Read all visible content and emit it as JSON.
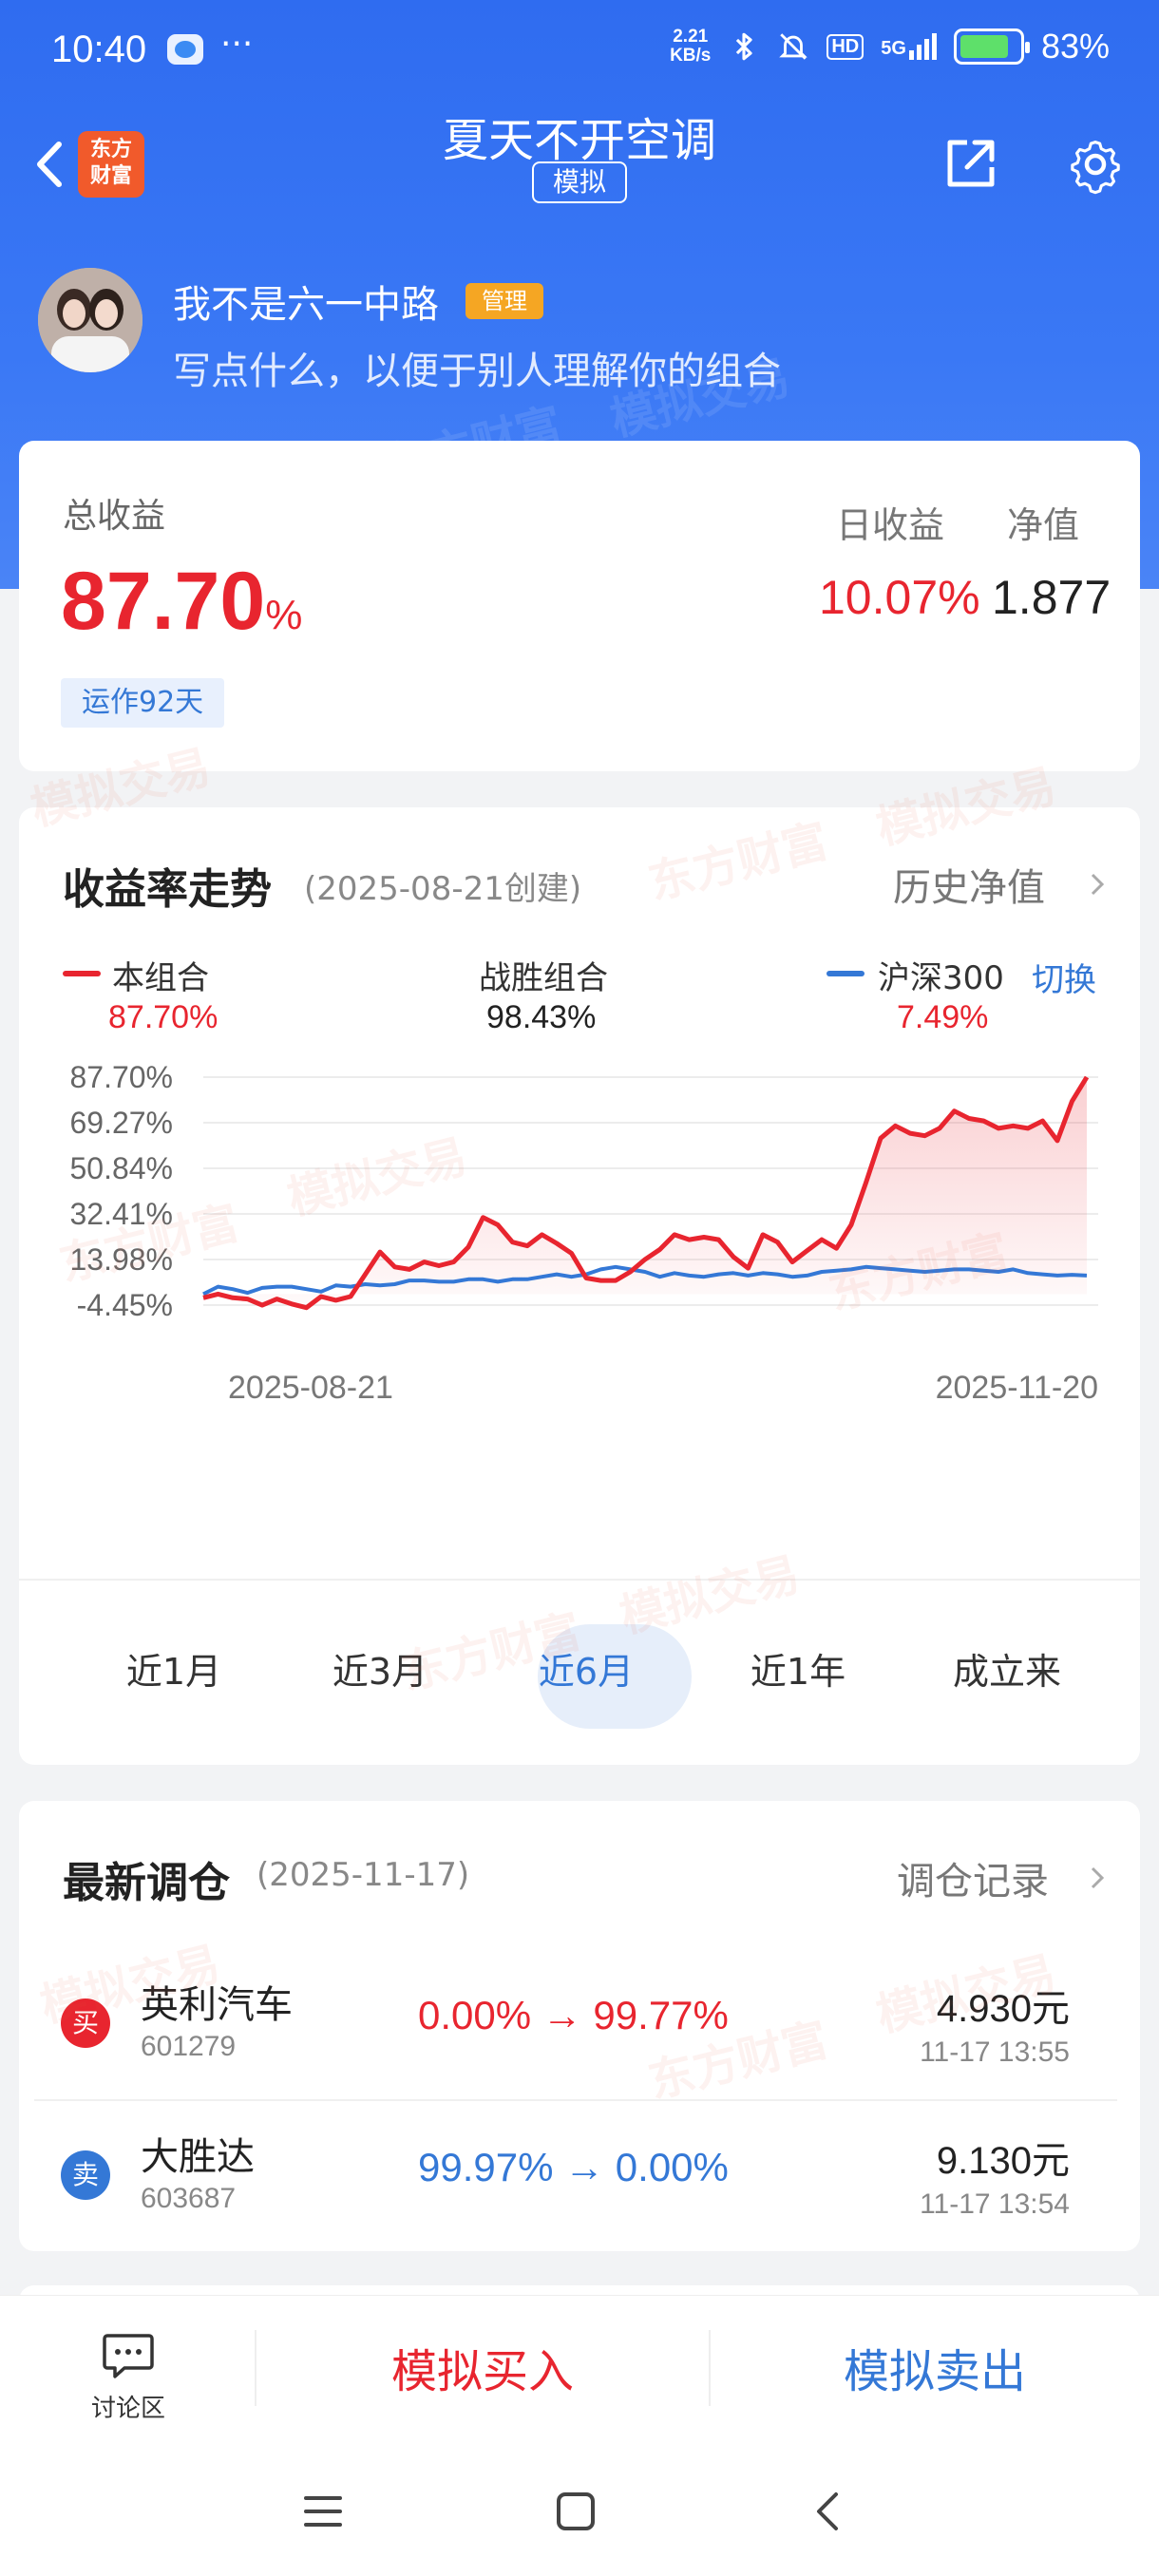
{
  "status_bar": {
    "time": "10:40",
    "more": "···",
    "net_speed_value": "2.21",
    "net_speed_unit": "KB/s",
    "signal": "5G",
    "hd": "HD",
    "battery": "83%"
  },
  "header": {
    "brand": [
      "东方",
      "财富"
    ],
    "title": "夏天不开空调",
    "mode_tag": "模拟"
  },
  "user": {
    "name": "我不是六一中路",
    "role_tag": "管理",
    "description": "写点什么，以便于别人理解你的组合"
  },
  "summary": {
    "total_label": "总收益",
    "total_value": "87.70",
    "total_unit": "%",
    "running_tag": "运作92天",
    "day_label": "日收益",
    "day_value": "10.07%",
    "nav_label": "净值",
    "nav_value": "1.877"
  },
  "chart_section": {
    "title": "收益率走势",
    "created": "(2025-08-21创建)",
    "history_link": "历史净值",
    "legend": [
      {
        "label": "本组合",
        "value": "87.70%",
        "color": "#e8252f"
      },
      {
        "label": "战胜组合",
        "value": "98.43%"
      },
      {
        "label": "沪深300",
        "value": "7.49%",
        "color": "#3478d6"
      }
    ],
    "switch_label": "切换",
    "tabs": [
      "近1月",
      "近3月",
      "近6月",
      "近1年",
      "成立来"
    ],
    "active_tab": "近6月"
  },
  "chart_data": {
    "type": "line",
    "yticks": [
      "87.70%",
      "69.27%",
      "50.84%",
      "32.41%",
      "13.98%",
      "-4.45%"
    ],
    "ylim": [
      -4.45,
      87.7
    ],
    "xticks": [
      "2025-08-21",
      "2025-11-20"
    ],
    "series": [
      {
        "name": "本组合",
        "color": "#e8252f",
        "values": [
          -1.5,
          0,
          -1.5,
          -2,
          -4.5,
          -2,
          -4,
          -5.5,
          -1,
          -2.5,
          -1,
          8,
          17,
          11,
          10,
          13,
          11.5,
          13,
          19,
          31,
          28,
          21,
          19.5,
          24,
          20.5,
          16.5,
          6.5,
          5.5,
          5.5,
          9,
          14,
          18,
          24,
          22,
          23,
          22,
          15,
          10.5,
          24,
          21,
          13,
          17.5,
          22,
          18.5,
          28,
          45,
          63,
          68,
          65,
          64,
          67,
          74,
          71,
          70,
          67,
          68,
          67,
          70,
          62,
          78,
          87.7
        ]
      },
      {
        "name": "沪深300",
        "color": "#3478d6",
        "values": [
          0,
          3,
          2,
          0.5,
          2.5,
          3,
          3,
          2,
          1,
          3.5,
          3,
          4,
          3.5,
          4,
          5.5,
          5.5,
          5,
          5,
          6,
          6,
          5,
          6,
          6,
          7,
          8,
          7,
          8,
          10,
          11,
          10,
          9,
          7,
          8.5,
          7.5,
          7,
          8,
          8.5,
          7.5,
          8.5,
          8,
          7,
          7.5,
          9,
          9.5,
          10,
          11,
          10.5,
          10,
          9.5,
          9,
          9.5,
          10,
          10,
          9.5,
          9,
          10,
          8.5,
          8,
          7.5,
          7.8,
          7.5
        ]
      }
    ],
    "grid": true
  },
  "rebalance": {
    "title": "最新调仓",
    "date": "(2025-11-17)",
    "record_link": "调仓记录",
    "items": [
      {
        "action": "买",
        "action_color": "#e8252f",
        "name": "英利汽车",
        "code": "601279",
        "change": "0.00% → 99.77%",
        "change_color": "#e8252f",
        "price": "4.930元",
        "time": "11-17  13:55"
      },
      {
        "action": "卖",
        "action_color": "#3478d6",
        "name": "大胜达",
        "code": "603687",
        "change": "99.97% → 0.00%",
        "change_color": "#3478d6",
        "price": "9.130元",
        "time": "11-17  13:54"
      }
    ]
  },
  "bottom_bar": {
    "discussion": "讨论区",
    "buy": "模拟买入",
    "sell": "模拟卖出"
  },
  "watermarks": [
    "东方财富",
    "模拟交易"
  ]
}
